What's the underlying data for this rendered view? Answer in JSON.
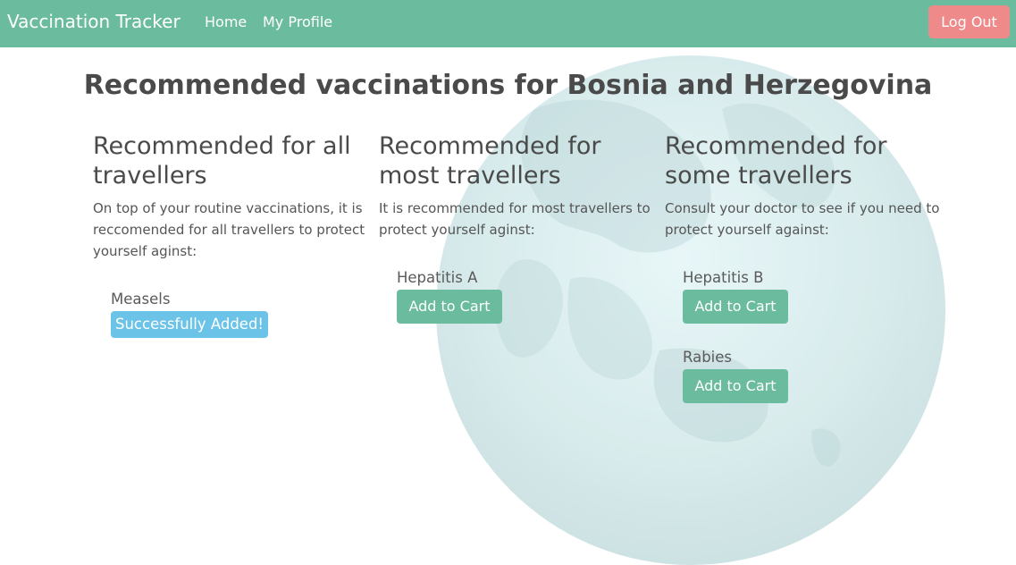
{
  "colors": {
    "nav_bg": "#6bbc9f",
    "logout_bg": "#ef8a8a",
    "button_bg": "#6bbc9f",
    "success_bg": "#6cc3e8"
  },
  "navbar": {
    "brand": "Vaccination Tracker",
    "links": [
      "Home",
      "My Profile"
    ],
    "logout_label": "Log Out"
  },
  "main": {
    "title": "Recommended vaccinations for Bosnia and Herzegovina",
    "columns": [
      {
        "heading_line1": "Recommended for all",
        "heading_line2": "travellers",
        "desc_lines": [
          "On top of your routine vaccinations, it is",
          "reccomended for all travellers to protect",
          "yourself aginst:"
        ],
        "vaccines": [
          {
            "name": "Measels",
            "status": "Successfully Added!"
          }
        ]
      },
      {
        "heading_line1": "Recommended for",
        "heading_line2": "most travellers",
        "desc_lines": [
          "It is recommended for most travellers to",
          "protect yourself aginst:"
        ],
        "vaccines": [
          {
            "name": "Hepatitis A",
            "button": "Add to Cart"
          }
        ]
      },
      {
        "heading_line1": "Recommended for",
        "heading_line2": "some travellers",
        "desc_lines": [
          "Consult your doctor to see if you need to",
          "protect yourself against:"
        ],
        "vaccines": [
          {
            "name": "Hepatitis B",
            "button": "Add to Cart"
          },
          {
            "name": "Rabies",
            "button": "Add to Cart"
          }
        ]
      }
    ]
  }
}
